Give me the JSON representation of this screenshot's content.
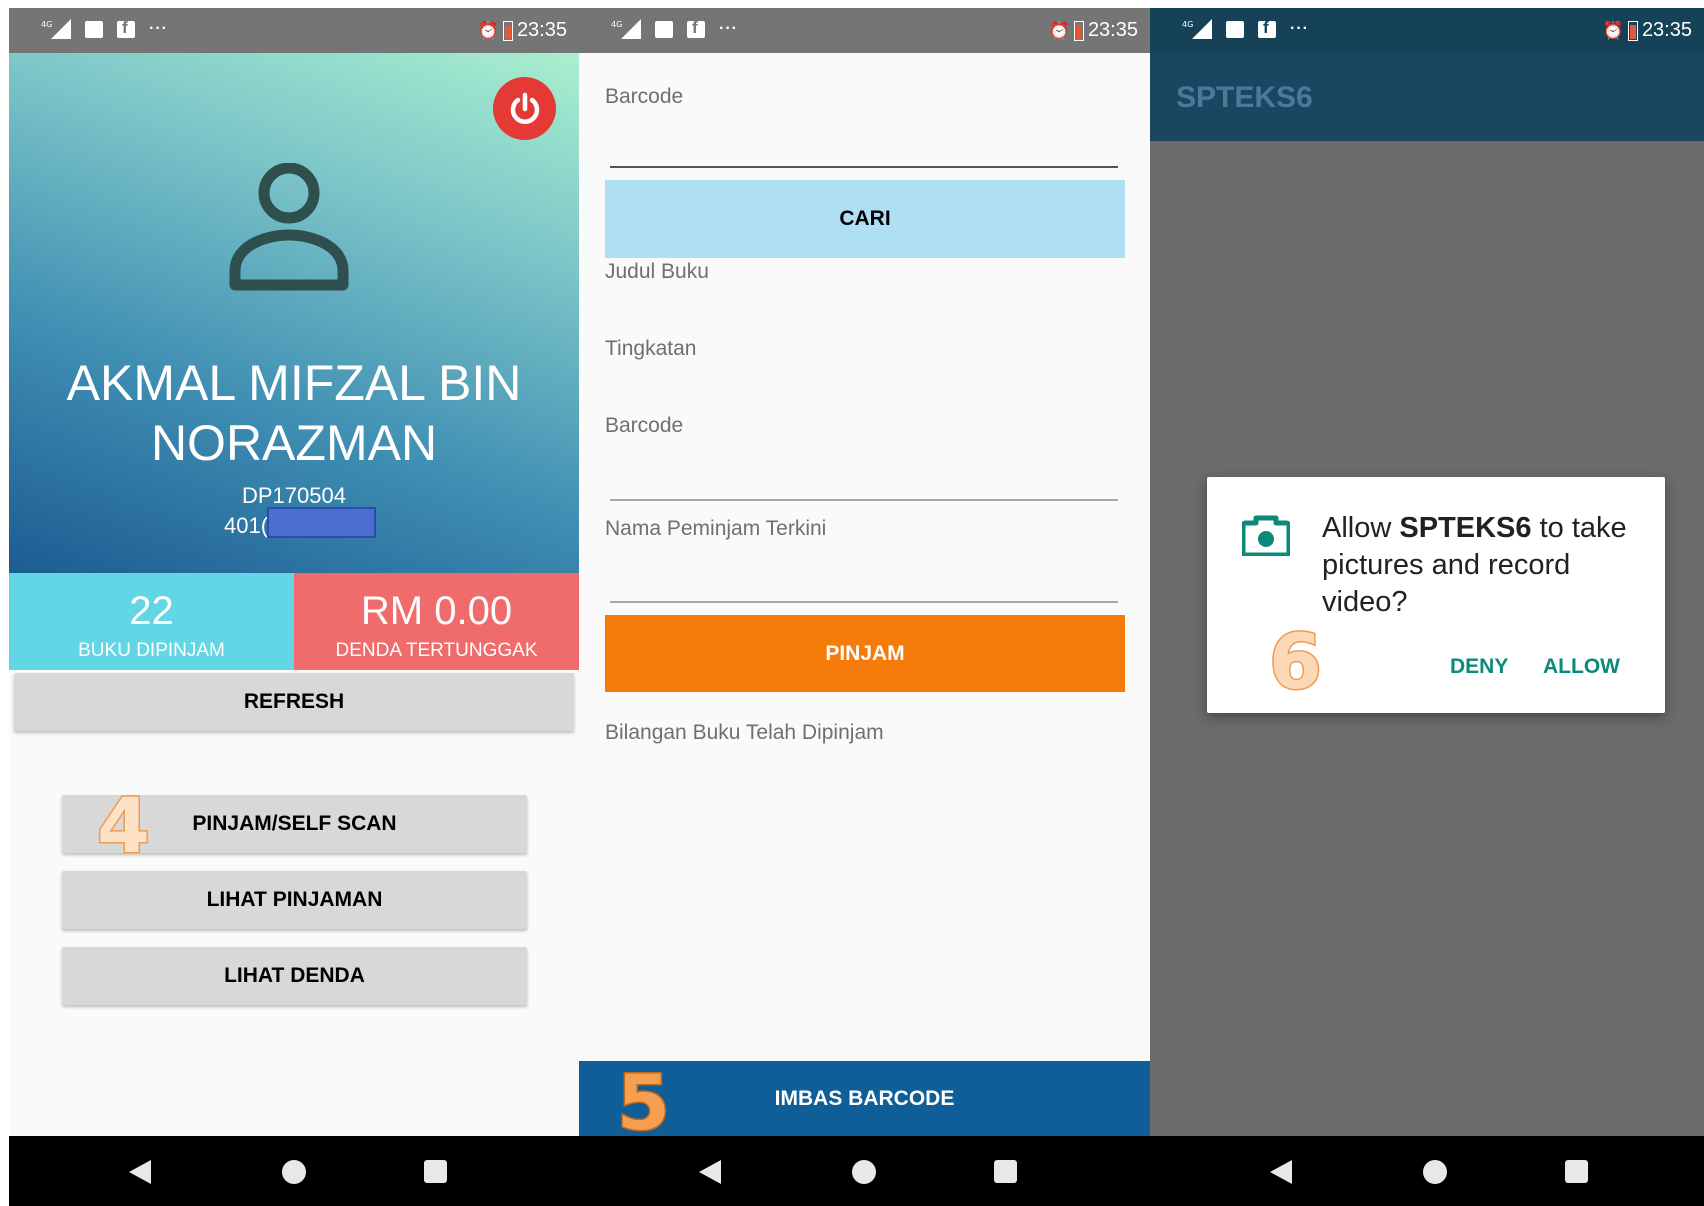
{
  "status_bar": {
    "network": "4G",
    "dots": "···",
    "time": "23:35"
  },
  "screen1": {
    "student": {
      "name": "AKMAL MIFZAL BIN NORAZMAN",
      "student_id": "DP170504",
      "ic_prefix": "401("
    },
    "stats": {
      "books_value": "22",
      "books_label": "BUKU DIPINJAM",
      "fine_value": "RM 0.00",
      "fine_label": "DENDA TERTUNGGAK"
    },
    "buttons": {
      "refresh": "REFRESH",
      "pinjam_scan": "PINJAM/SELF SCAN",
      "lihat_pinjaman": "LIHAT PINJAMAN",
      "lihat_denda": "LIHAT DENDA"
    },
    "step_marker": "4"
  },
  "screen2": {
    "labels": {
      "barcode_top": "Barcode",
      "judul_buku": "Judul Buku",
      "tingkatan": "Tingkatan",
      "barcode": "Barcode",
      "nama_peminjam": "Nama Peminjam Terkini",
      "bilangan_buku": "Bilangan Buku Telah Dipinjam"
    },
    "buttons": {
      "cari": "CARI",
      "pinjam": "PINJAM",
      "imbas_barcode": "IMBAS BARCODE"
    },
    "step_marker": "5"
  },
  "screen3": {
    "app_title": "SPTEKS6",
    "dialog": {
      "prefix": "Allow ",
      "app_name": "SPTEKS6",
      "suffix": " to take pictures and record video?",
      "deny": "DENY",
      "allow": "ALLOW"
    },
    "step_marker": "6"
  },
  "colors": {
    "books_stat": "#62d6e5",
    "fine_stat": "#f06b6b",
    "cari_button": "#aedff3",
    "pinjam_button": "#f57c0b",
    "imbas_button": "#105e98",
    "power_button": "#e53935",
    "dialog_action": "#0b8a7a",
    "appbar": "#1b4661"
  },
  "icons": [
    "signal-icon",
    "image-icon",
    "facebook-icon",
    "alarm-icon",
    "battery-icon",
    "power-icon",
    "user-icon",
    "camera-icon",
    "back-icon",
    "home-icon",
    "recents-icon"
  ]
}
